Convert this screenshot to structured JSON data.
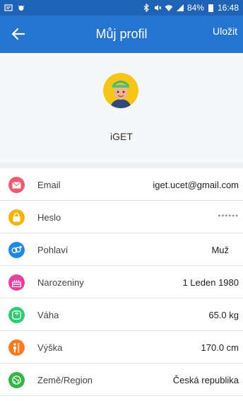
{
  "statusbar": {
    "battery": "84%",
    "time": "16:48"
  },
  "appbar": {
    "title": "Můj profil",
    "save_label": "Uložit"
  },
  "profile": {
    "username": "iGET"
  },
  "fields": [
    {
      "label": "Email",
      "value": "iget.ucet@gmail.com",
      "icon": "mail-icon",
      "color": "#ef5b6e"
    },
    {
      "label": "Heslo",
      "value": "******",
      "icon": "lock-icon",
      "color": "#f6b400"
    },
    {
      "label": "Pohlaví",
      "value": "Muž",
      "icon": "gender-icon",
      "color": "#1e88e5"
    },
    {
      "label": "Narozeniny",
      "value": "1 Leden 1980",
      "icon": "cake-icon",
      "color": "#ea3f9e"
    },
    {
      "label": "Váha",
      "value": "65.0 kg",
      "icon": "scale-icon",
      "color": "#2ecc71"
    },
    {
      "label": "Výška",
      "value": "170.0 cm",
      "icon": "height-icon",
      "color": "#fb7a1f"
    },
    {
      "label": "Země/Region",
      "value": "Česká republika",
      "icon": "globe-icon",
      "color": "#37b34a"
    }
  ]
}
